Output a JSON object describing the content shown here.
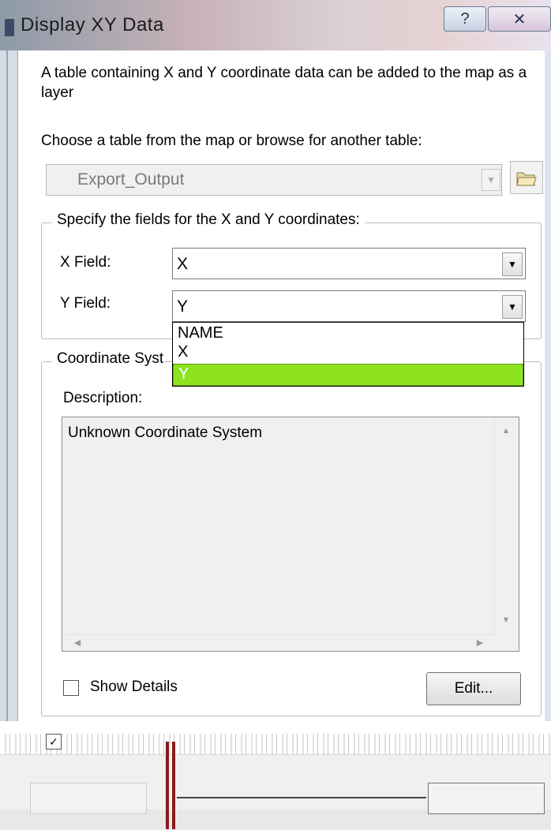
{
  "window": {
    "title": "Display XY Data",
    "help_icon": "help-icon",
    "close_icon": "close-icon"
  },
  "intro_text": "A table containing X and Y coordinate data can be added to the map as a layer",
  "choose_label": "Choose a table from the map or browse for another table:",
  "table_combo": {
    "value": "Export_Output",
    "enabled": false
  },
  "browse_icon": "folder-open-icon",
  "xy_group": {
    "legend": "Specify the fields for the X and Y coordinates:",
    "x_label": "X Field:",
    "x_value": "X",
    "y_label": "Y Field:",
    "y_value": "Y",
    "dropdown_options": [
      "NAME",
      "X",
      "Y"
    ],
    "dropdown_selected": "Y"
  },
  "coordinate_system": {
    "legend": "Coordinate Syst",
    "description_label": "Description:",
    "description_text": "Unknown Coordinate System",
    "show_details_label": "Show Details",
    "show_details_checked": false,
    "edit_label": "Edit..."
  },
  "colors": {
    "selection": "#8ee321",
    "titlebar": "#c7b2b7"
  }
}
